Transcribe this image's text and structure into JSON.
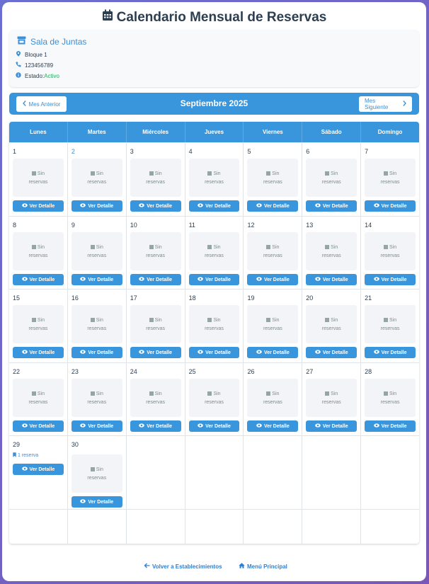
{
  "title": "Calendario Mensual de Reservas",
  "venue": {
    "name": "Sala de Juntas",
    "address": "Bloque 1",
    "phone": "123456789",
    "status_label": "Estado:",
    "status_value": "Activo"
  },
  "nav": {
    "prev": "Mes Anterior",
    "month": "Septiembre 2025",
    "next": "Mes Siguiente"
  },
  "weekdays": [
    "Lunes",
    "Martes",
    "Miércoles",
    "Jueves",
    "Viernes",
    "Sábado",
    "Domingo"
  ],
  "empty_line1": "Sin",
  "empty_line2": "reservas",
  "detail_label": "Ver Detalle",
  "days": [
    {
      "n": "1"
    },
    {
      "n": "2",
      "highlight": true
    },
    {
      "n": "3"
    },
    {
      "n": "4"
    },
    {
      "n": "5"
    },
    {
      "n": "6"
    },
    {
      "n": "7"
    },
    {
      "n": "8"
    },
    {
      "n": "9"
    },
    {
      "n": "10"
    },
    {
      "n": "11"
    },
    {
      "n": "12"
    },
    {
      "n": "13"
    },
    {
      "n": "14"
    },
    {
      "n": "15"
    },
    {
      "n": "16"
    },
    {
      "n": "17"
    },
    {
      "n": "18"
    },
    {
      "n": "19"
    },
    {
      "n": "20"
    },
    {
      "n": "21"
    },
    {
      "n": "22"
    },
    {
      "n": "23"
    },
    {
      "n": "24"
    },
    {
      "n": "25"
    },
    {
      "n": "26"
    },
    {
      "n": "27"
    },
    {
      "n": "28"
    },
    {
      "n": "29",
      "reservas": "1 reserva"
    },
    {
      "n": "30"
    }
  ],
  "footer": {
    "back": "Volver a Establecimientos",
    "menu": "Menú Principal"
  },
  "colors": {
    "accent": "#3a96dc",
    "status_ok": "#27ae60",
    "background_gradient": [
      "#6a6fd0",
      "#7a56b8"
    ]
  }
}
